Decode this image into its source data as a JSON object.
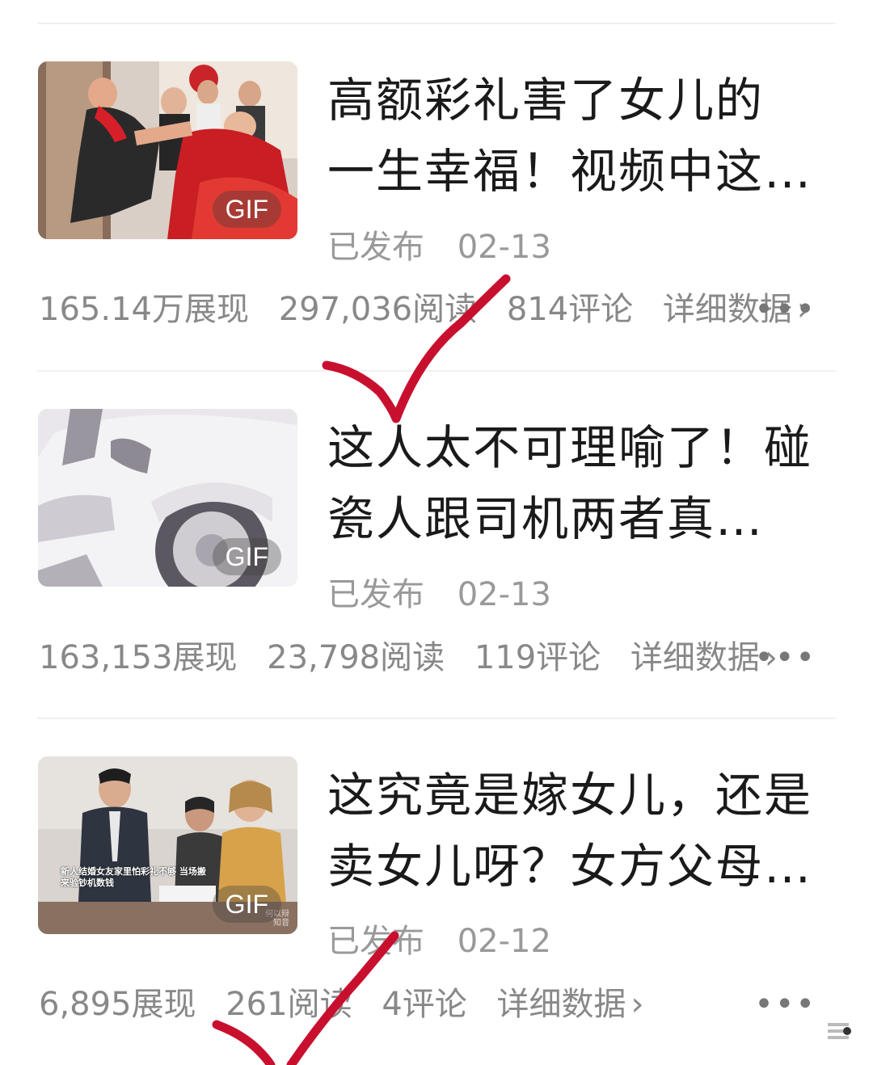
{
  "articles": [
    {
      "title_line1": "高额彩礼害了女儿的",
      "title_line2": "一生幸福！视频中这…",
      "badge": "GIF",
      "status": "已发布",
      "date": "02-13",
      "impressions": "165.14万展现",
      "reads": "297,036阅读",
      "comments": "814评论",
      "detail_label": "详细数据",
      "more_icon": "more-dots-icon"
    },
    {
      "title_line1": "这人太不可理喻了！碰",
      "title_line2": "瓷人跟司机两者真…",
      "badge": "GIF",
      "status": "已发布",
      "date": "02-13",
      "impressions": "163,153展现",
      "reads": "23,798阅读",
      "comments": "119评论",
      "detail_label": "详细数据",
      "more_icon": "more-dots-icon"
    },
    {
      "title_line1": "这究竟是嫁女儿，还是",
      "title_line2": "卖女儿呀？女方父母…",
      "badge": "GIF",
      "status": "已发布",
      "date": "02-12",
      "impressions": "6,895展现",
      "reads": "261阅读",
      "comments": "4评论",
      "detail_label": "详细数据",
      "more_icon": "more-dots-icon",
      "thumb_caption": "新人结婚女友家里怕彩礼不够 当场搬来验钞机数钱",
      "thumb_watermark": "何以辩 知音"
    }
  ],
  "icons": {
    "chevron": "chevron-right-icon",
    "more": "more-dots-icon",
    "checkmark": "red-checkmark-annotation"
  },
  "colors": {
    "title": "#1a1a1a",
    "meta": "#999999",
    "stats": "#888888",
    "annotation": "#c8102e",
    "divider": "#f0f0f0"
  },
  "glyphs": {
    "chevron": "›",
    "more": "•••"
  }
}
